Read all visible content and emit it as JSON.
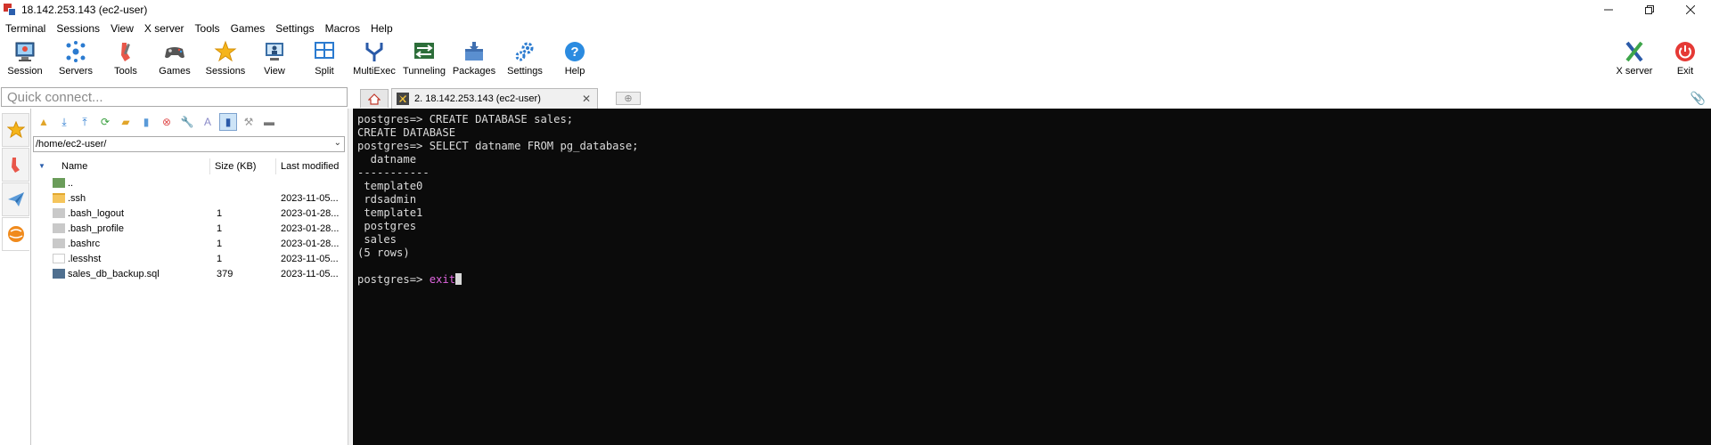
{
  "window": {
    "title": "18.142.253.143 (ec2-user)"
  },
  "menu": [
    "Terminal",
    "Sessions",
    "View",
    "X server",
    "Tools",
    "Games",
    "Settings",
    "Macros",
    "Help"
  ],
  "toolbar": {
    "session": "Session",
    "servers": "Servers",
    "tools": "Tools",
    "games": "Games",
    "sessions": "Sessions",
    "view": "View",
    "split": "Split",
    "multiexec": "MultiExec",
    "tunneling": "Tunneling",
    "packages": "Packages",
    "settings": "Settings",
    "help": "Help",
    "xserver": "X server",
    "exit": "Exit"
  },
  "quick_connect": {
    "placeholder": "Quick connect..."
  },
  "tabs": {
    "active": "2. 18.142.253.143 (ec2-user)"
  },
  "sftp": {
    "path": "/home/ec2-user/",
    "columns": {
      "name": "Name",
      "size": "Size (KB)",
      "modified": "Last modified"
    },
    "files": [
      {
        "name": "..",
        "size": "",
        "modified": "",
        "type": "parent"
      },
      {
        "name": ".ssh",
        "size": "",
        "modified": "2023-11-05...",
        "type": "folder"
      },
      {
        "name": ".bash_logout",
        "size": "1",
        "modified": "2023-01-28...",
        "type": "file"
      },
      {
        "name": ".bash_profile",
        "size": "1",
        "modified": "2023-01-28...",
        "type": "file"
      },
      {
        "name": ".bashrc",
        "size": "1",
        "modified": "2023-01-28...",
        "type": "file"
      },
      {
        "name": ".lesshst",
        "size": "1",
        "modified": "2023-11-05...",
        "type": "blank"
      },
      {
        "name": "sales_db_backup.sql",
        "size": "379",
        "modified": "2023-11-05...",
        "type": "sql"
      }
    ]
  },
  "terminal": {
    "lines": [
      "postgres=> CREATE DATABASE sales;",
      "CREATE DATABASE",
      "postgres=> SELECT datname FROM pg_database;",
      "  datname",
      "-----------",
      " template0",
      " rdsadmin",
      " template1",
      " postgres",
      " sales",
      "(5 rows)",
      ""
    ],
    "prompt": "postgres=> ",
    "current_input": "exit"
  }
}
